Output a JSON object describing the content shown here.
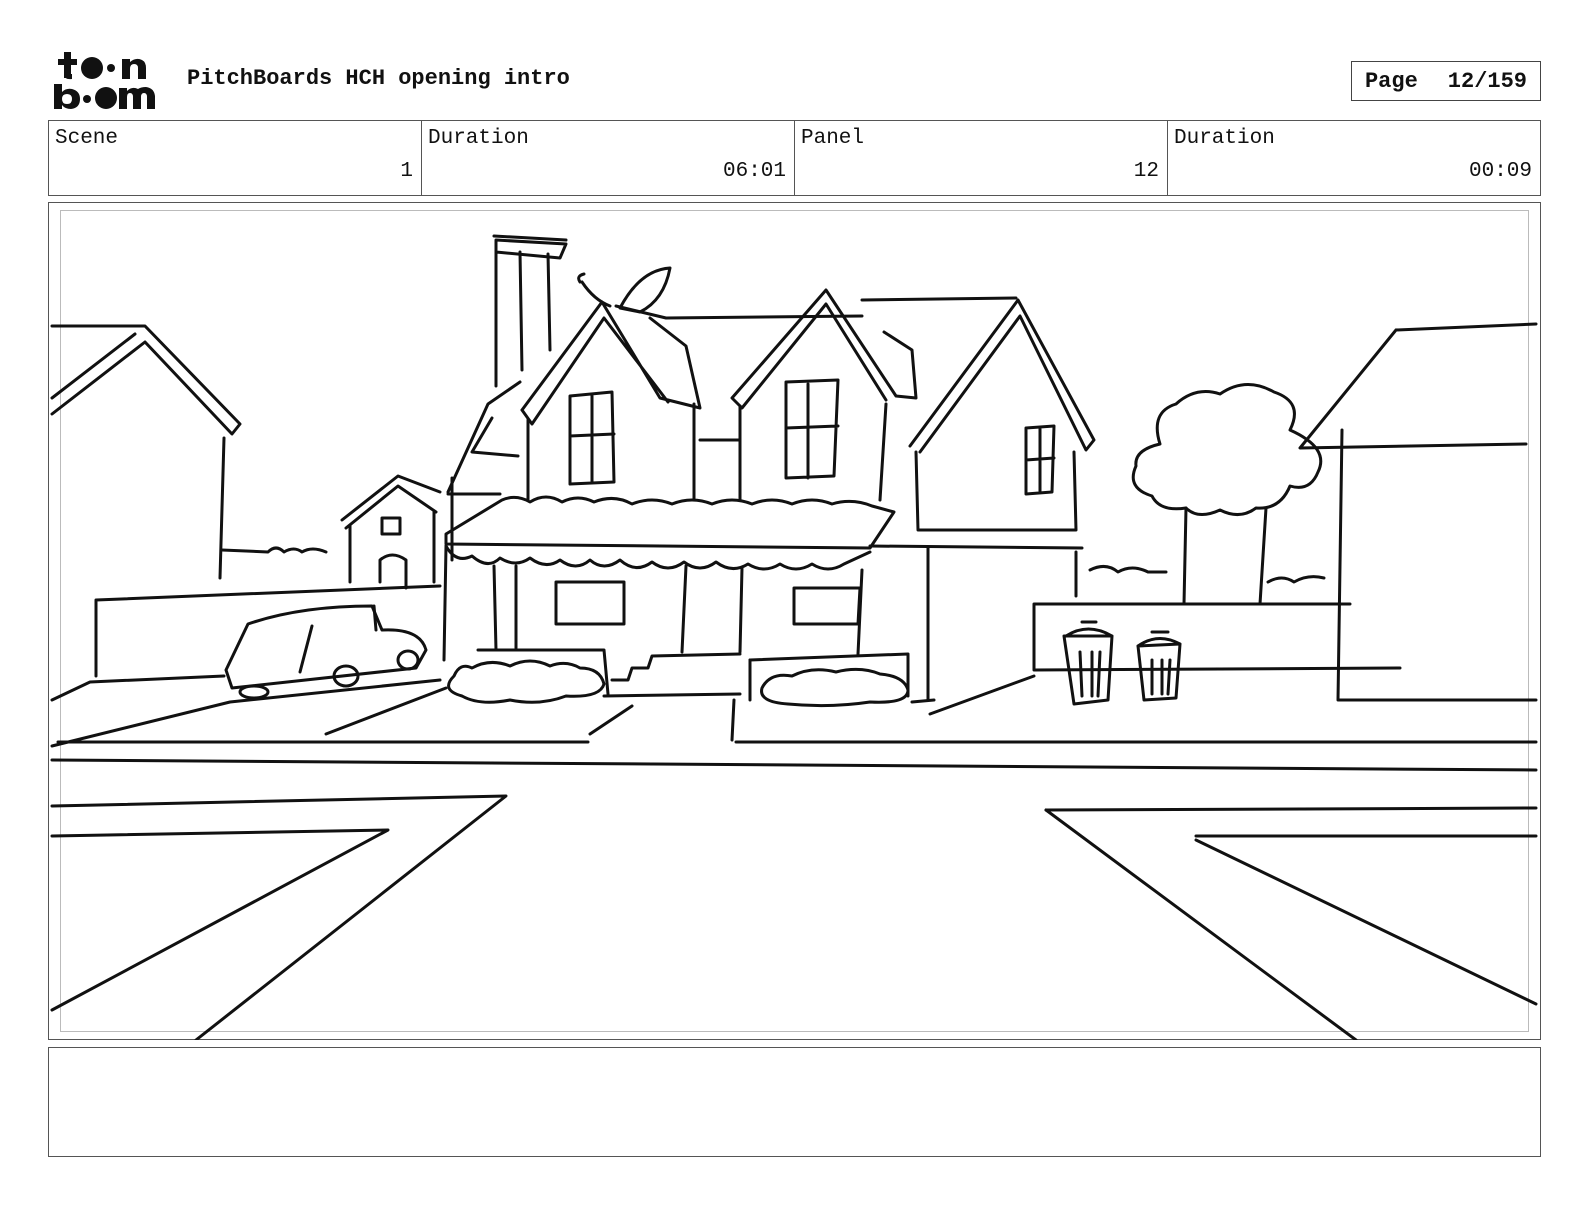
{
  "header": {
    "logo_text": "toonboom",
    "project_title": "PitchBoards HCH opening intro",
    "page_label": "Page",
    "page_value": "12/159"
  },
  "info": {
    "scene": {
      "label": "Scene",
      "value": "1"
    },
    "scene_duration": {
      "label": "Duration",
      "value": "06:01"
    },
    "panel": {
      "label": "Panel",
      "value": "12"
    },
    "panel_duration": {
      "label": "Duration",
      "value": "00:09"
    }
  },
  "notes": {
    "text": ""
  }
}
